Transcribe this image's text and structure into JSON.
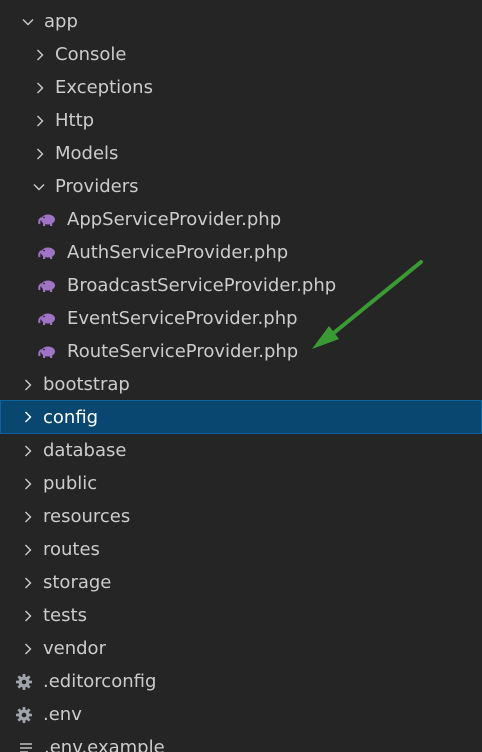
{
  "explorer": {
    "items": [
      {
        "label": "app",
        "type": "folder",
        "expanded": true,
        "depth": 0
      },
      {
        "label": "Console",
        "type": "folder",
        "expanded": false,
        "depth": 1
      },
      {
        "label": "Exceptions",
        "type": "folder",
        "expanded": false,
        "depth": 1
      },
      {
        "label": "Http",
        "type": "folder",
        "expanded": false,
        "depth": 1
      },
      {
        "label": "Models",
        "type": "folder",
        "expanded": false,
        "depth": 1
      },
      {
        "label": "Providers",
        "type": "folder",
        "expanded": true,
        "depth": 1
      },
      {
        "label": "AppServiceProvider.php",
        "type": "php-file",
        "depth": 2
      },
      {
        "label": "AuthServiceProvider.php",
        "type": "php-file",
        "depth": 2
      },
      {
        "label": "BroadcastServiceProvider.php",
        "type": "php-file",
        "depth": 2
      },
      {
        "label": "EventServiceProvider.php",
        "type": "php-file",
        "depth": 2
      },
      {
        "label": "RouteServiceProvider.php",
        "type": "php-file",
        "depth": 2
      },
      {
        "label": "bootstrap",
        "type": "folder",
        "expanded": false,
        "depth": 0
      },
      {
        "label": "config",
        "type": "folder",
        "expanded": false,
        "depth": 0,
        "selected": true
      },
      {
        "label": "database",
        "type": "folder",
        "expanded": false,
        "depth": 0
      },
      {
        "label": "public",
        "type": "folder",
        "expanded": false,
        "depth": 0
      },
      {
        "label": "resources",
        "type": "folder",
        "expanded": false,
        "depth": 0
      },
      {
        "label": "routes",
        "type": "folder",
        "expanded": false,
        "depth": 0
      },
      {
        "label": "storage",
        "type": "folder",
        "expanded": false,
        "depth": 0
      },
      {
        "label": "tests",
        "type": "folder",
        "expanded": false,
        "depth": 0
      },
      {
        "label": "vendor",
        "type": "folder",
        "expanded": false,
        "depth": 0
      },
      {
        "label": ".editorconfig",
        "type": "gear-file",
        "depth": 0
      },
      {
        "label": ".env",
        "type": "gear-file",
        "depth": 0
      },
      {
        "label": ".env.example",
        "type": "text-file",
        "depth": 0
      }
    ]
  },
  "colors": {
    "background": "#252526",
    "selection": "#094771",
    "text": "#cccccc",
    "php_icon": "#a074c4",
    "annotation_arrow": "#3a9b35"
  },
  "annotation": {
    "icon": "green-arrow-icon",
    "points_to": "RouteServiceProvider.php"
  }
}
